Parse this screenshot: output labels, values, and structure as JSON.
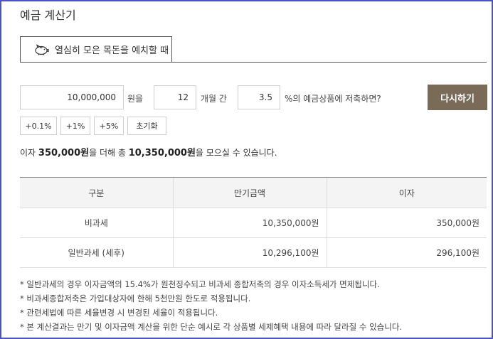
{
  "title": "예금 계산기",
  "tab": {
    "label": "열심히 모은 목돈을 예치할 때",
    "icon": "piggy-bank-icon"
  },
  "form": {
    "amount_value": "10,000,000",
    "amount_unit": "원을",
    "months_value": "12",
    "months_unit": "개월 간",
    "rate_value": "3.5",
    "rate_unit": "%의 예금상품에 저축하면?",
    "reset_label": "다시하기"
  },
  "chips": [
    "+0.1%",
    "+1%",
    "+5%",
    "초기화"
  ],
  "result": {
    "prefix": "이자",
    "interest": "350,000원",
    "mid": "을 더해 총",
    "total": "10,350,000원",
    "suffix": "을 모으실 수 있습니다."
  },
  "table": {
    "headers": [
      "구분",
      "만기금액",
      "이자"
    ],
    "rows": [
      [
        "비과세",
        "10,350,000원",
        "350,000원"
      ],
      [
        "일반과세 (세후)",
        "10,296,100원",
        "296,100원"
      ]
    ]
  },
  "notes": [
    "* 일반과세의 경우 이자금액의 15.4%가 원천징수되고 비과세 종합저축의 경우 이자소득세가 면제됩니다.",
    "* 비과세종합저축은 가입대상자에 한해 5천만원 한도로 적용됩니다.",
    "* 관련세법에 따른 세율변경 시 변경된 세율이 적용됩니다.",
    "* 본 계산결과는 만기 및 이자금액 계산을 위한 단순 예시로 각 상품별 세제혜택 내용에 따라 달라질 수 있습니다."
  ],
  "colors": {
    "frame": "#4a52c8",
    "reset_button": "#7a6a58"
  }
}
